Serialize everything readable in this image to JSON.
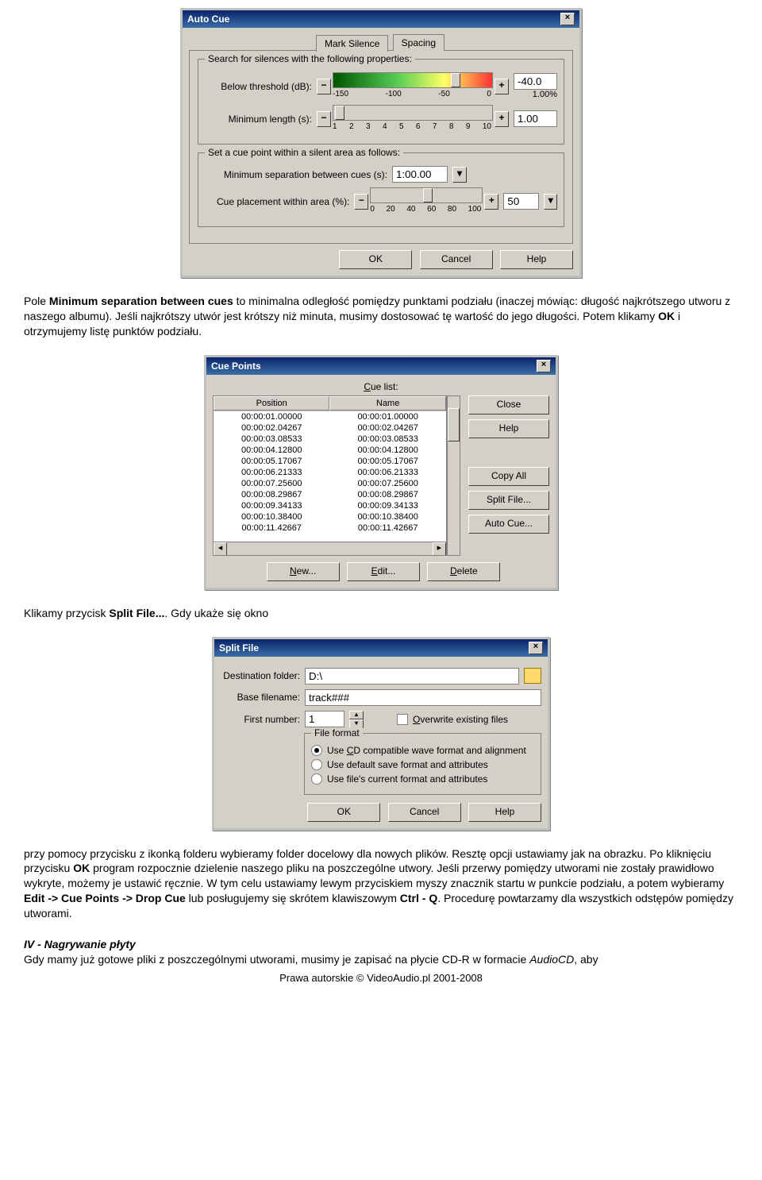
{
  "autocue": {
    "title": "Auto Cue",
    "tabs": [
      "Mark Silence",
      "Spacing"
    ],
    "group1": "Search for silences with the following properties:",
    "below_threshold_label": "Below threshold (dB):",
    "below_threshold_value": "-40.0",
    "below_threshold_pct": "1.00%",
    "ticks1": [
      "-150",
      "-100",
      "-50",
      "0"
    ],
    "min_length_label": "Minimum length (s):",
    "min_length_value": "1.00",
    "ticks2": [
      "1",
      "2",
      "3",
      "4",
      "5",
      "6",
      "7",
      "8",
      "9",
      "10"
    ],
    "group2": "Set a cue point within a silent area as follows:",
    "min_sep_label": "Minimum separation between cues (s):",
    "min_sep_value": "1:00.00",
    "cue_place_label": "Cue placement within area (%):",
    "cue_place_value": "50",
    "ticks3": [
      "0",
      "20",
      "40",
      "60",
      "80",
      "100"
    ],
    "ok": "OK",
    "cancel": "Cancel",
    "help": "Help"
  },
  "para1": {
    "t1": "Pole ",
    "b1": "Minimum separation between cues",
    "t2": " to minimalna odległość pomiędzy punktami podziału (inaczej mówiąc: długość najkrótszego utworu z naszego albumu). Jeśli najkrótszy utwór jest krótszy niż minuta, musimy dostosować tę wartość do jego długości. Potem klikamy ",
    "b2": "OK",
    "t3": " i otrzymujemy listę punktów podziału."
  },
  "cuepoints": {
    "title": "Cue Points",
    "cue_list": "Cue list:",
    "cols": [
      "Position",
      "Name"
    ],
    "rows": [
      [
        "00:00:01.00000",
        "00:00:01.00000"
      ],
      [
        "00:00:02.04267",
        "00:00:02.04267"
      ],
      [
        "00:00:03.08533",
        "00:00:03.08533"
      ],
      [
        "00:00:04.12800",
        "00:00:04.12800"
      ],
      [
        "00:00:05.17067",
        "00:00:05.17067"
      ],
      [
        "00:00:06.21333",
        "00:00:06.21333"
      ],
      [
        "00:00:07.25600",
        "00:00:07.25600"
      ],
      [
        "00:00:08.29867",
        "00:00:08.29867"
      ],
      [
        "00:00:09.34133",
        "00:00:09.34133"
      ],
      [
        "00:00:10.38400",
        "00:00:10.38400"
      ],
      [
        "00:00:11.42667",
        "00:00:11.42667"
      ]
    ],
    "close": "Close",
    "help": "Help",
    "copyall": "Copy All",
    "splitfile": "Split File...",
    "autocue": "Auto Cue...",
    "new": "New...",
    "edit": "Edit...",
    "delete": "Delete"
  },
  "para2": {
    "t1": "Klikamy przycisk ",
    "b1": "Split File...",
    "t2": ". Gdy ukaże się okno"
  },
  "splitfile": {
    "title": "Split File",
    "dest_label": "Destination folder:",
    "dest_value": "D:\\",
    "base_label": "Base filename:",
    "base_value": "track###",
    "first_label": "First number:",
    "first_value": "1",
    "overwrite": "Overwrite existing files",
    "group": "File format",
    "r1": "Use CD compatible wave format and alignment",
    "r2": "Use default save format and attributes",
    "r3": "Use file's current format and attributes",
    "ok": "OK",
    "cancel": "Cancel",
    "help": "Help"
  },
  "para3": {
    "t1": "przy pomocy przycisku z ikonką folderu wybieramy folder docelowy dla nowych plików. Resztę opcji ustawiamy jak na obrazku. Po kliknięciu przycisku ",
    "b1": "OK",
    "t2": " program rozpocznie dzielenie naszego pliku na poszczególne utwory. Jeśli przerwy pomiędzy utworami nie zostały prawidłowo wykryte, możemy je ustawić ręcznie. W tym celu ustawiamy lewym przyciskiem myszy znacznik startu w punkcie podziału, a potem wybieramy ",
    "b2": "Edit -> Cue Points -> Drop Cue",
    "t3": " lub posługujemy się skrótem klawiszowym ",
    "b3": "Ctrl - Q",
    "t4": ". Procedurę powtarzamy dla wszystkich odstępów pomiędzy utworami."
  },
  "para4": {
    "h": "IV - Nagrywanie płyty",
    "t1": "Gdy mamy już gotowe pliki z poszczególnymi utworami, musimy je zapisać na płycie CD-R w formacie ",
    "i1": "AudioCD",
    "t2": ", aby"
  },
  "footer": "Prawa autorskie © VideoAudio.pl 2001-2008"
}
